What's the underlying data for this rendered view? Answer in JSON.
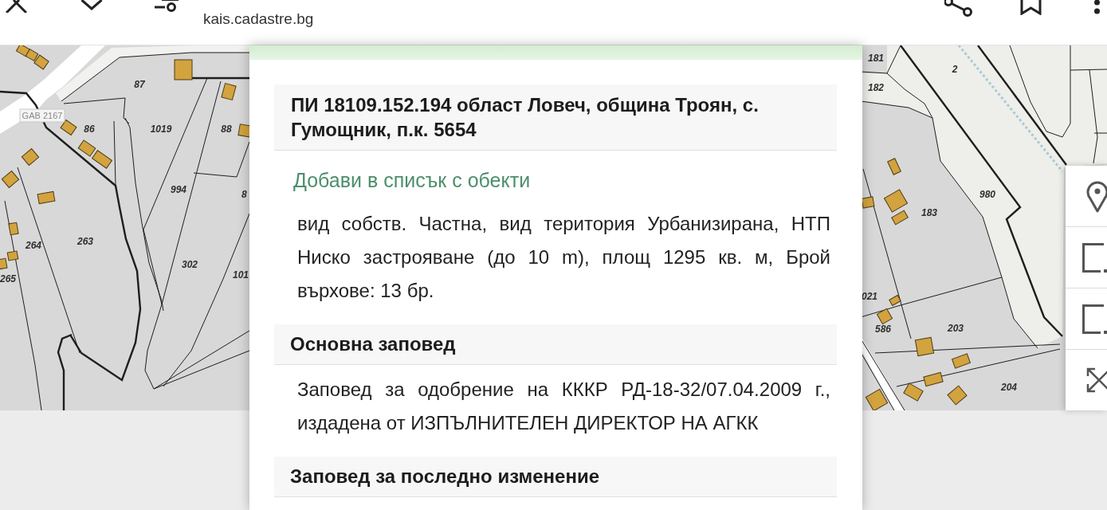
{
  "browser_bar": {
    "url": "kais.cadastre.bg"
  },
  "map": {
    "left_labels": [
      "87",
      "86",
      "1019",
      "88",
      "8",
      "994",
      "264",
      "263",
      "302",
      "265",
      "101"
    ],
    "road_label": "GAB 2167",
    "right_labels": [
      "181",
      "2",
      "182",
      "980",
      "183",
      "021",
      "586",
      "203",
      "204"
    ]
  },
  "parcel_panel": {
    "title": "ПИ 18109.152.194 област Ловеч, община Троян, с. Гумощник, п.к. 5654",
    "add_link": "Добави в списък с обекти",
    "details": "вид собств. Частна, вид територия Урбанизирана, НТП Ниско застрояване (до 10 m), площ 1295 кв. м, Брой върхове: 13 бр.",
    "sections": [
      {
        "heading": "Основна заповед",
        "text": "Заповед за одобрение на КККР РД-18-32/07.04.2009 г., издадена от ИЗПЪЛНИТЕЛЕН ДИРЕКТОР НА АГКК"
      },
      {
        "heading": "Заповед за последно изменение"
      }
    ]
  }
}
